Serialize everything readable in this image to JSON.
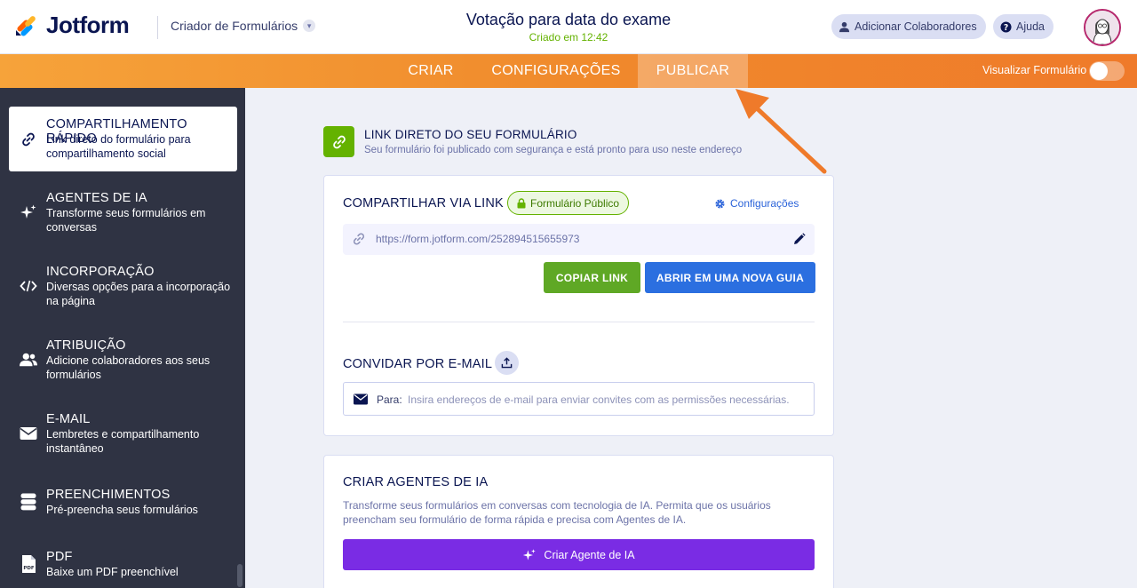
{
  "header": {
    "logo_text": "Jotform",
    "builder_label": "Criador de Formulários",
    "form_title": "Votação para data do exame",
    "form_subtitle": "Criado em 12:42",
    "add_collaborators": "Adicionar Colaboradores",
    "help": "Ajuda"
  },
  "nav": {
    "tabs": [
      {
        "label": "CRIAR"
      },
      {
        "label": "CONFIGURAÇÕES"
      },
      {
        "label": "PUBLICAR"
      }
    ],
    "active_tab": "PUBLICAR",
    "preview_label": "Visualizar Formulário"
  },
  "sidebar": {
    "items": [
      {
        "title": "COMPARTILHAMENTO RÁPIDO",
        "desc": "Link direto do formulário para compartilhamento social",
        "icon": "link-icon"
      },
      {
        "title": "AGENTES DE IA",
        "desc": "Transforme seus formulários em conversas",
        "icon": "sparkle-icon"
      },
      {
        "title": "INCORPORAÇÃO",
        "desc": "Diversas opções para a incorporação na página",
        "icon": "code-icon"
      },
      {
        "title": "ATRIBUIÇÃO",
        "desc": "Adicione colaboradores aos seus formulários",
        "icon": "users-icon"
      },
      {
        "title": "E-MAIL",
        "desc": "Lembretes e compartilhamento instantâneo",
        "icon": "mail-icon"
      },
      {
        "title": "PREENCHIMENTOS",
        "desc": "Pré-preencha seus formulários",
        "icon": "database-icon"
      },
      {
        "title": "PDF",
        "desc": "Baixe um PDF preenchível",
        "icon": "pdf-icon"
      }
    ]
  },
  "main": {
    "direct_link": {
      "title": "LINK DIRETO DO SEU FORMULÁRIO",
      "subtitle": "Seu formulário foi publicado com segurança e está pronto para uso neste endereço"
    },
    "share": {
      "title": "COMPARTILHAR VIA LINK",
      "badge": "Formulário Público",
      "settings": "Configurações",
      "url": "https://form.jotform.com/252894515655973",
      "copy_button": "COPIAR LINK",
      "open_button": "ABRIR EM UMA NOVA GUIA"
    },
    "invite": {
      "title": "CONVIDAR POR E-MAIL",
      "to_label": "Para:",
      "placeholder": "Insira endereços de e-mail para enviar convites com as permissões necessárias."
    },
    "ai": {
      "title": "CRIAR AGENTES DE IA",
      "description": "Transforme seus formulários em conversas com tecnologia de IA. Permita que os usuários preencham seu formulário de forma rápida e precisa com Agentes de IA.",
      "button": "Criar Agente de IA"
    }
  },
  "colors": {
    "brand_orange": "#f08a2c",
    "sidebar_bg": "#2f3343",
    "green": "#64b200",
    "blue": "#2b63d9",
    "purple": "#7a2ce4",
    "annotation_arrow": "#ef7a2a"
  }
}
